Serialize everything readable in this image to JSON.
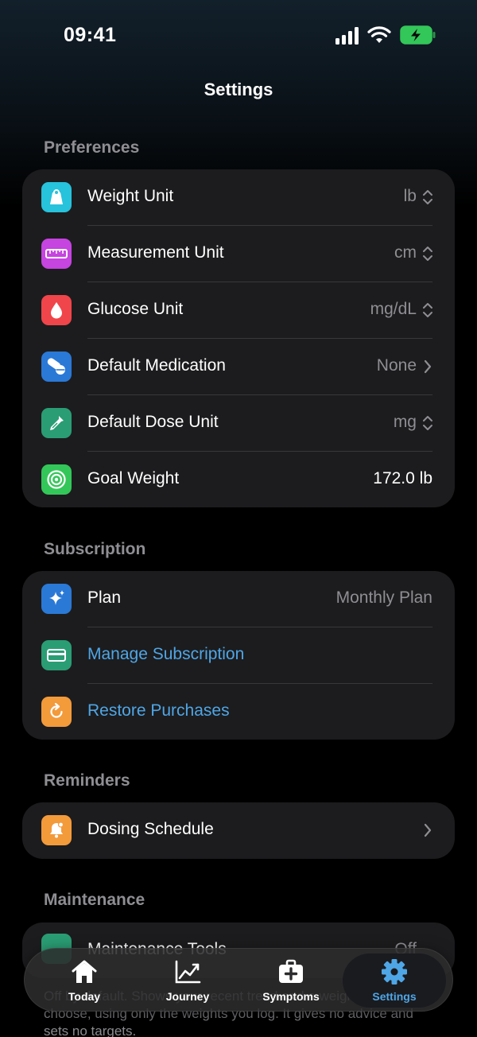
{
  "status_bar": {
    "time": "09:41"
  },
  "nav": {
    "title": "Settings"
  },
  "preferences": {
    "header": "Preferences",
    "rows": [
      {
        "label": "Weight Unit",
        "value": "lb",
        "icon": "scale-icon",
        "icon_color": "#27c2dc"
      },
      {
        "label": "Measurement Unit",
        "value": "cm",
        "icon": "ruler-icon",
        "icon_color": "#c644e0"
      },
      {
        "label": "Glucose Unit",
        "value": "mg/dL",
        "icon": "drop-icon",
        "icon_color": "#f0454a"
      },
      {
        "label": "Default Medication",
        "value": "None",
        "icon": "pills-icon",
        "icon_color": "#2a79d6"
      },
      {
        "label": "Default Dose Unit",
        "value": "mg",
        "icon": "dropper-icon",
        "icon_color": "#2a9d74"
      },
      {
        "label": "Goal Weight",
        "value": "172.0 lb",
        "icon": "target-icon",
        "icon_color": "#33c759"
      }
    ]
  },
  "subscription": {
    "header": "Subscription",
    "rows": [
      {
        "label": "Plan",
        "value": "Monthly Plan",
        "icon": "sparkles-icon",
        "icon_color": "#2a79d6"
      },
      {
        "label": "Manage Subscription",
        "icon": "card-icon",
        "icon_color": "#2a9d74"
      },
      {
        "label": "Restore Purchases",
        "icon": "restore-icon",
        "icon_color": "#f39a3b"
      }
    ]
  },
  "reminders": {
    "header": "Reminders",
    "rows": [
      {
        "label": "Dosing Schedule",
        "icon": "bell-icon",
        "icon_color": "#f39a3b"
      }
    ]
  },
  "maintenance": {
    "header": "Maintenance",
    "peek_label": "Maintenance Tools",
    "peek_value": "Off"
  },
  "footer": {
    "text": "Off by default. Shows your recent trend and a weight range you choose, using only the weights you log. It gives no advice and sets no targets."
  },
  "tab_bar": {
    "tabs": [
      {
        "label": "Today",
        "icon": "house-icon"
      },
      {
        "label": "Journey",
        "icon": "chart-line-icon"
      },
      {
        "label": "Symptoms",
        "icon": "medkit-icon"
      },
      {
        "label": "Settings",
        "icon": "gear-icon",
        "active": true
      }
    ]
  },
  "colors": {
    "accent": "#4fa6e6",
    "card": "#1c1c1e",
    "secondary_text": "#8e8e93"
  }
}
